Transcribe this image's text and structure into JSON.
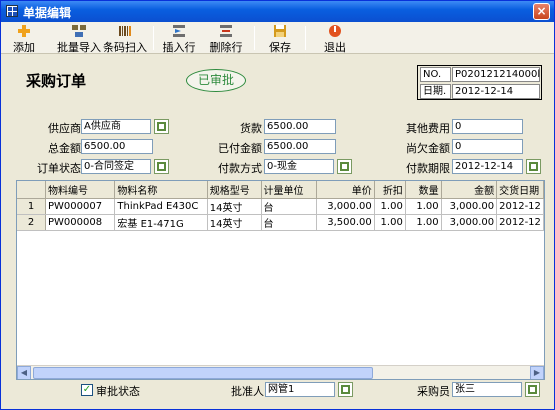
{
  "window": {
    "title": "单据编辑",
    "close_glyph": "×"
  },
  "toolbar": {
    "add": "添加",
    "batch_import": "批量导入",
    "barcode_scan": "条码扫入",
    "insert_row": "插入行",
    "delete_row": "删除行",
    "save": "保存",
    "exit": "退出"
  },
  "doc": {
    "title": "采购订单",
    "status_stamp": "已审批",
    "no_label": "NO.",
    "no_value": "P020121214000l",
    "date_label": "日期.",
    "date_value": "2012-12-14"
  },
  "form": {
    "supplier_label": "供应商",
    "supplier_value": "A供应商",
    "goods_amount_label": "货款",
    "goods_amount_value": "6500.00",
    "other_fee_label": "其他费用",
    "other_fee_value": "0",
    "total_label": "总金额",
    "total_value": "6500.00",
    "paid_label": "已付金额",
    "paid_value": "6500.00",
    "owed_label": "尚欠金额",
    "owed_value": "0",
    "order_status_label": "订单状态",
    "order_status_value": "0-合同签定",
    "pay_method_label": "付款方式",
    "pay_method_value": "0-现金",
    "pay_due_label": "付款期限",
    "pay_due_value": "2012-12-14"
  },
  "grid": {
    "columns": [
      "物料编号",
      "物料名称",
      "规格型号",
      "计量单位",
      "单价",
      "折扣",
      "数量",
      "金额",
      "交货日期"
    ],
    "rows": [
      {
        "rownum": "1",
        "code": "PW000007",
        "name": "ThinkPad E430C",
        "spec": "14英寸",
        "unit": "台",
        "price": "3,000.00",
        "discount": "1.00",
        "qty": "1.00",
        "amount": "3,000.00",
        "delivery": "2012-12"
      },
      {
        "rownum": "2",
        "code": "PW000008",
        "name": "宏基 E1-471G",
        "spec": "14英寸",
        "unit": "台",
        "price": "3,500.00",
        "discount": "1.00",
        "qty": "1.00",
        "amount": "3,000.00",
        "delivery": "2012-12"
      }
    ]
  },
  "footer": {
    "approval_label": "审批状态",
    "approval_checked": "✓",
    "approver_label": "批准人",
    "approver_value": "网管1",
    "buyer_label": "采购员",
    "buyer_value": "张三"
  }
}
